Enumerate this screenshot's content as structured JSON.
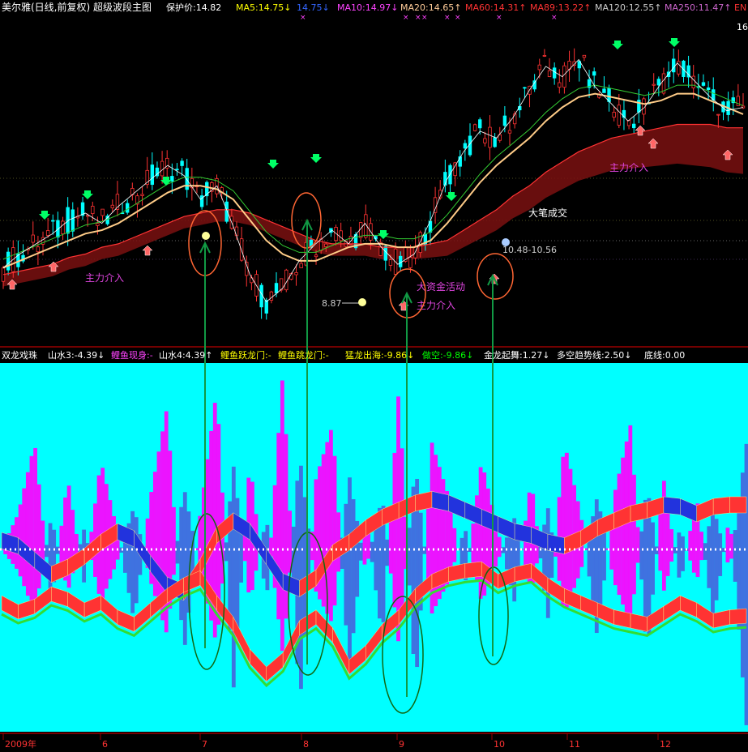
{
  "header": {
    "title": "美尔雅(日线,前复权) 超级波段主图",
    "items": [
      {
        "label": "保护价:14.82",
        "color": "#ffffff"
      },
      {
        "label": "MA5:14.75↓",
        "color": "#ffff00"
      },
      {
        "label": "14.75↓",
        "color": "#3366ff"
      },
      {
        "label": "MA10:14.97↓",
        "color": "#ff44ff"
      },
      {
        "label": "MA20:14.65↑",
        "color": "#ffcc99"
      },
      {
        "label": "MA60:14.31↑",
        "color": "#ff3333"
      },
      {
        "label": "MA89:13.22↑",
        "color": "#ff3333"
      },
      {
        "label": "MA120:12.55↑",
        "color": "#cccccc"
      },
      {
        "label": "MA250:11.47↑",
        "color": "#cc66cc"
      },
      {
        "label": "EN",
        "color": "#ff3333"
      }
    ],
    "corner_value": "16"
  },
  "annotations": {
    "zhuli_1": "主力介入",
    "zhuli_2": "主力介入",
    "zhuli_3": "主力介入",
    "dazijin": "大资金活动",
    "dabi": "大笔成交",
    "low_price": "8.87",
    "cross_price": "10.48-10.56"
  },
  "indicator": {
    "title": "双龙戏珠",
    "items": [
      {
        "label": "山水3:-4.39↓",
        "color": "#ffffff"
      },
      {
        "label": "鲤鱼现身:-",
        "color": "#ff44ff"
      },
      {
        "label": "山水4:4.39↑",
        "color": "#ffffff"
      },
      {
        "label": "鲤鱼跃龙门:-",
        "color": "#ffff00"
      },
      {
        "label": "鲤鱼跳龙门:-",
        "color": "#ffff00"
      },
      {
        "label": "猛龙出海:-9.86↓",
        "color": "#ffff00"
      },
      {
        "label": "做空:-9.86↓",
        "color": "#00ff00"
      },
      {
        "label": "金龙起舞:1.27↓",
        "color": "#ffffff"
      },
      {
        "label": "多空趋势线:2.50↓",
        "color": "#ffffff"
      },
      {
        "label": "底线:0.00",
        "color": "#ffffff"
      }
    ]
  },
  "xaxis": {
    "labels": [
      "2009年",
      "6",
      "7",
      "8",
      "9",
      "10",
      "11",
      "12"
    ]
  },
  "colors": {
    "up": "#ff3333",
    "down": "#00ffff",
    "indicator_bg": "#00ffff",
    "magenta": "#ff00ff",
    "blue": "#2233dd",
    "red": "#ff3333",
    "green": "#33dd33",
    "arrow_green": "#00ff66",
    "circle": "#ff6633"
  },
  "chart_data": [
    {
      "type": "candlestick",
      "title": "美尔雅(日线,前复权) 超级波段主图",
      "x": [
        "2009年",
        "6",
        "7",
        "8",
        "9",
        "10",
        "11",
        "12"
      ],
      "low_marked": 8.87,
      "cross_range": [
        10.48,
        10.56
      ],
      "close_trend": [
        10.2,
        10.6,
        10.9,
        11.2,
        11.6,
        11.8,
        11.5,
        12.0,
        12.4,
        12.8,
        13.2,
        12.9,
        12.2,
        12.6,
        11.4,
        10.0,
        9.2,
        9.6,
        10.4,
        10.9,
        11.3,
        10.9,
        11.5,
        10.8,
        10.3,
        10.6,
        11.6,
        12.8,
        13.6,
        14.2,
        14.0,
        14.6,
        15.4,
        16.1,
        15.8,
        16.3,
        15.5,
        15.0,
        14.5,
        14.9,
        15.6,
        16.2,
        15.7,
        15.2,
        14.8,
        14.9
      ],
      "ma_trends": [
        {
          "name": "MA20",
          "values": [
            10.2,
            10.4,
            10.6,
            10.8,
            11.0,
            11.2,
            11.3,
            11.5,
            11.8,
            12.1,
            12.4,
            12.6,
            12.6,
            12.5,
            12.2,
            11.6,
            11.0,
            10.6,
            10.4,
            10.4,
            10.6,
            10.8,
            10.9,
            10.9,
            10.8,
            10.8,
            11.0,
            11.5,
            12.1,
            12.7,
            13.2,
            13.6,
            14.0,
            14.5,
            14.9,
            15.2,
            15.3,
            15.2,
            15.1,
            15.0,
            15.1,
            15.3,
            15.3,
            15.1,
            14.9,
            14.7
          ]
        },
        {
          "name": "MA60",
          "values": [
            10.0,
            10.1,
            10.2,
            10.3,
            10.5,
            10.6,
            10.8,
            10.9,
            11.1,
            11.3,
            11.5,
            11.7,
            11.8,
            11.9,
            11.9,
            11.8,
            11.6,
            11.4,
            11.2,
            11.0,
            10.9,
            10.9,
            10.9,
            10.8,
            10.8,
            10.8,
            10.9,
            11.0,
            11.3,
            11.6,
            11.9,
            12.3,
            12.6,
            13.0,
            13.3,
            13.6,
            13.8,
            14.0,
            14.1,
            14.2,
            14.3,
            14.4,
            14.4,
            14.4,
            14.3,
            14.3
          ]
        }
      ]
    },
    {
      "type": "area",
      "title": "双龙戏珠",
      "x": [
        "2009年",
        "6",
        "7",
        "8",
        "9",
        "10",
        "11",
        "12"
      ],
      "series": [
        {
          "name": "猛龙出海",
          "values": [
            0,
            2,
            6,
            -3,
            4,
            -2,
            5,
            1,
            -4,
            3,
            8,
            -6,
            2,
            9,
            -8,
            5,
            -3,
            10,
            -9,
            4,
            7,
            -7,
            2,
            -5,
            9,
            -8,
            6,
            3,
            -2,
            5,
            1,
            -3,
            4,
            -4,
            6,
            2,
            -5,
            3,
            7,
            -6,
            4,
            -2,
            3,
            -4,
            2,
            -9.86
          ]
        },
        {
          "name": "金龙起舞",
          "values": [
            2.0,
            1.5,
            1.8,
            2.5,
            2.2,
            1.6,
            2.0,
            1.2,
            0.8,
            1.6,
            2.4,
            3.0,
            3.4,
            2.0,
            0.8,
            -1.0,
            -2.0,
            -1.2,
            0.6,
            1.2,
            0.2,
            -1.6,
            -0.8,
            0.4,
            1.2,
            2.4,
            3.2,
            3.6,
            3.8,
            3.9,
            3.2,
            3.6,
            3.8,
            3.0,
            2.4,
            2.0,
            1.6,
            1.2,
            1.0,
            0.8,
            1.4,
            2.0,
            1.6,
            1.0,
            1.2,
            1.27
          ]
        },
        {
          "name": "多空趋势线",
          "values": [
            0.5,
            0.2,
            -0.6,
            -1.4,
            -1.0,
            -0.4,
            0.4,
            1.0,
            0.6,
            -0.8,
            -2.0,
            -2.4,
            -1.0,
            0.8,
            1.6,
            1.0,
            -0.4,
            -1.8,
            -2.2,
            -1.6,
            -0.2,
            0.4,
            1.2,
            1.8,
            2.2,
            2.6,
            2.8,
            2.6,
            2.2,
            1.8,
            1.4,
            1.0,
            0.8,
            0.4,
            0.2,
            0.6,
            1.2,
            1.6,
            2.0,
            2.2,
            2.5,
            2.4,
            2.0,
            2.4,
            2.5,
            2.5
          ]
        },
        {
          "name": "底线",
          "values": [
            0
          ]
        }
      ]
    }
  ]
}
